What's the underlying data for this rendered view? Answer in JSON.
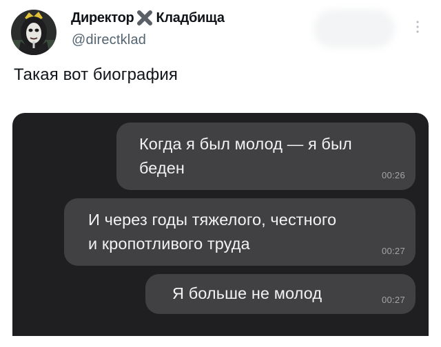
{
  "tweet": {
    "author": {
      "name_part1": "Директор",
      "name_part2": "Кладбища",
      "separator_icon": "x-icon",
      "handle": "@directklad",
      "avatar": "avatar-nun-mask"
    },
    "text": "Такая вот биография",
    "menu_icon": "more-vertical-icon"
  },
  "chat": {
    "messages": [
      {
        "lines": [
          "Когда я был молод — я был",
          "беден"
        ],
        "time": "00:26"
      },
      {
        "lines": [
          "И через годы тяжелого, честного",
          "и кропотливого труда"
        ],
        "time": "00:27"
      },
      {
        "lines": [
          "Я больше не молод"
        ],
        "time": "00:27"
      }
    ]
  },
  "colors": {
    "chat_background": "#1f1f21",
    "bubble": "#414144",
    "bubble_text": "#f2f2f2",
    "timestamp": "#a5a5a8",
    "handle_gray": "#536471",
    "x_icon": "#5b6066"
  }
}
